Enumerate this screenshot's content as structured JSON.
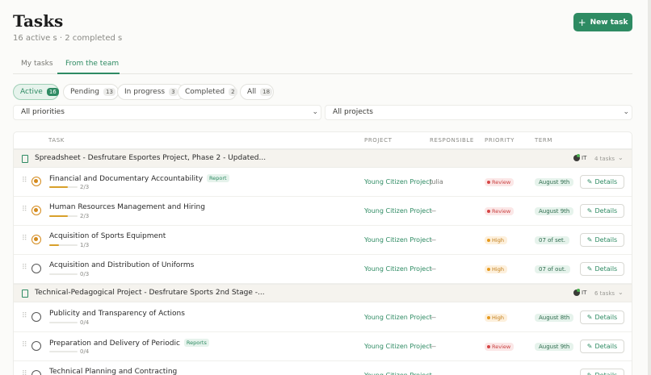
{
  "header": {
    "title": "Tasks",
    "subtitle": "16 active s · 2 completed s",
    "new_task_icon": "+",
    "new_task_label": "New task"
  },
  "tabs": [
    {
      "label": "My tasks"
    },
    {
      "label": "From the team"
    }
  ],
  "filters": [
    {
      "label": "Active",
      "count": "16"
    },
    {
      "label": "Pending",
      "count": "13"
    },
    {
      "label": "In progress",
      "count": "3"
    },
    {
      "label": "Completed",
      "count": "2"
    },
    {
      "label": "All",
      "count": "18"
    }
  ],
  "selects": {
    "priorities": "All priorities",
    "projects": "All projects",
    "chevron": "⌄"
  },
  "columns": {
    "task": "TASK",
    "project": "PROJECT",
    "responsible": "RESPONSIBLE",
    "priority": "PRIORITY",
    "term": "TERM"
  },
  "groups": [
    {
      "name": "Spreadsheet - Desfrutare Esportes Project, Phase 2 - Updated...",
      "tag": "IT",
      "count": "4 tasks",
      "chevron": "⌄"
    },
    {
      "name": "Technical-Pedagogical Project - Desfrutare Sports 2nd Stage -...",
      "tag": "IT",
      "count": "6 tasks",
      "chevron": "⌄"
    }
  ],
  "tasks": [
    {
      "name": "Financial and Documentary Accountability",
      "tag": "Report",
      "progress_text": "2/3",
      "progress": 0.667,
      "project": "Young Citizen Project",
      "responsible": "Julia",
      "priority": "Review",
      "term": "August 9th",
      "action": "Details",
      "status": "in-progress"
    },
    {
      "name": "Human Resources Management and Hiring",
      "tag": "",
      "progress_text": "2/3",
      "progress": 0.667,
      "project": "Young Citizen Project",
      "responsible": "—",
      "priority": "Review",
      "term": "August 9th",
      "action": "Details",
      "status": "in-progress"
    },
    {
      "name": "Acquisition of Sports Equipment",
      "tag": "",
      "progress_text": "1/3",
      "progress": 0.333,
      "project": "Young Citizen Project",
      "responsible": "—",
      "priority": "High",
      "term": "07 of set.",
      "action": "Details",
      "status": "in-progress"
    },
    {
      "name": "Acquisition and Distribution of Uniforms",
      "tag": "",
      "progress_text": "0/3",
      "progress": 0,
      "project": "Young Citizen Project",
      "responsible": "—",
      "priority": "High",
      "term": "07 of out.",
      "action": "Details",
      "status": "pending"
    },
    {
      "name": "Publicity and Transparency of Actions",
      "tag": "",
      "progress_text": "0/4",
      "progress": 0,
      "project": "Young Citizen Project",
      "responsible": "—",
      "priority": "High",
      "term": "August 8th",
      "action": "Details",
      "status": "pending"
    },
    {
      "name": "Preparation and Delivery of Periodic",
      "tag": "Reports",
      "progress_text": "0/4",
      "progress": 0,
      "project": "Young Citizen Project",
      "responsible": "—",
      "priority": "Review",
      "term": "August 9th",
      "action": "Details",
      "status": "pending"
    },
    {
      "name": "Technical Planning and Contracting",
      "tag": "",
      "progress_text": "",
      "progress": 0,
      "project": "Young Citizen Project",
      "responsible": "—",
      "priority": "",
      "term": "",
      "action": "Details",
      "status": "pending"
    }
  ],
  "colors": {
    "accent": "#2e8b63",
    "progress": "#d8a02a",
    "review": "#d64545",
    "high": "#e79a1e"
  }
}
